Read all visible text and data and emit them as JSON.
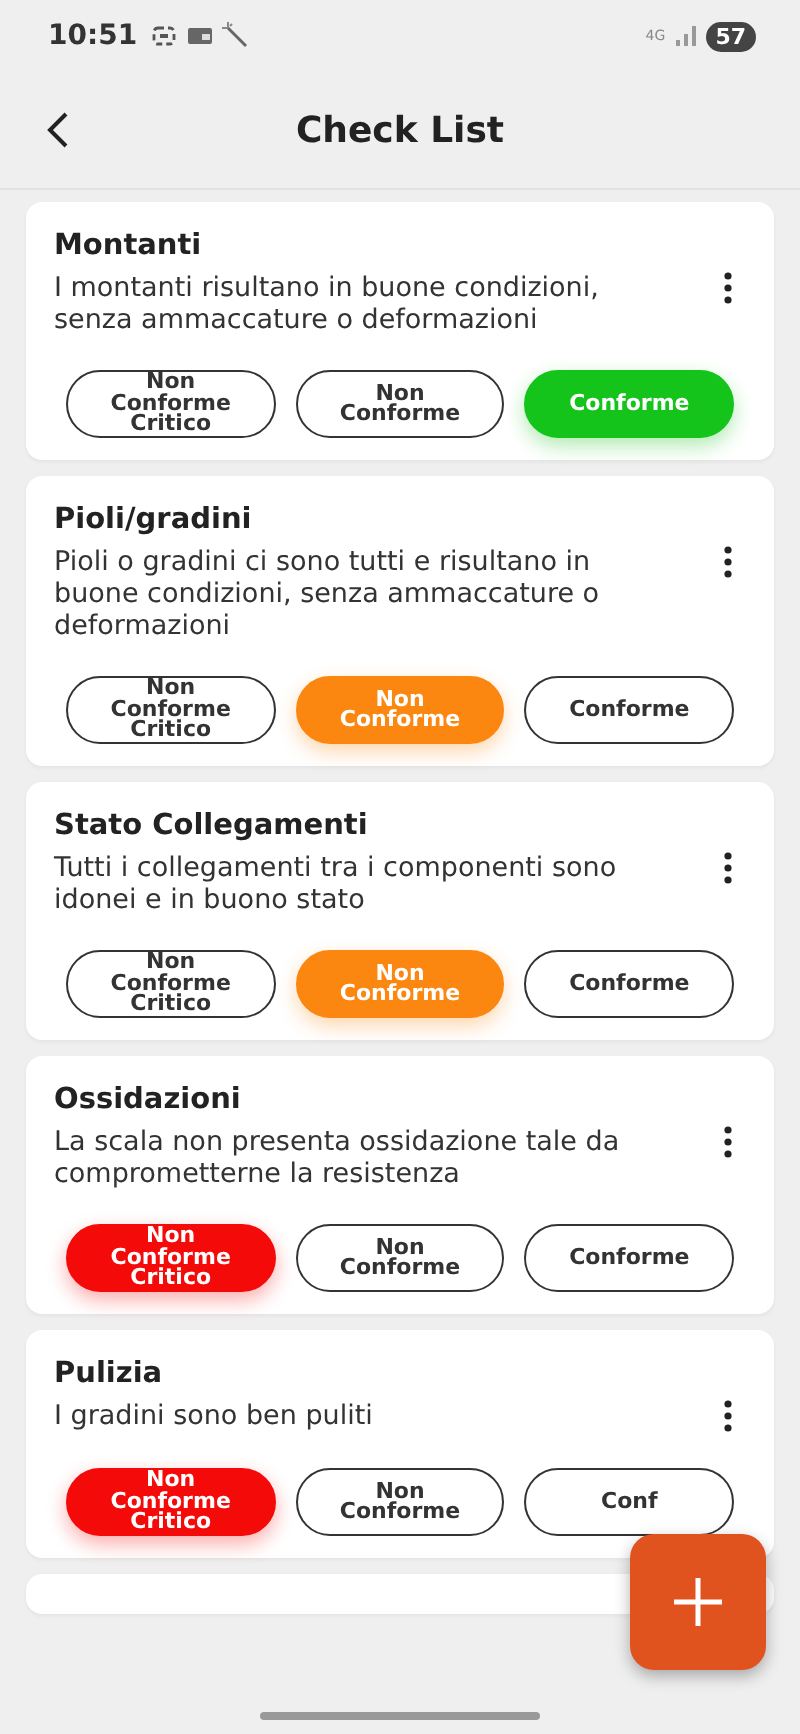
{
  "status_bar": {
    "time": "10:51",
    "network": "4G",
    "battery": "57"
  },
  "header": {
    "title": "Check List"
  },
  "items": [
    {
      "title": "Montanti",
      "description": "I montanti risultano in buone condizioni, senza ammaccature o deformazioni",
      "options": [
        {
          "kind": "critical",
          "label": "Non Conforme Critico",
          "selected": false
        },
        {
          "kind": "nonconform",
          "label": "Non Conforme",
          "selected": false
        },
        {
          "kind": "conform",
          "label": "Conforme",
          "selected": true
        }
      ]
    },
    {
      "title": "Pioli/gradini",
      "description": "Pioli o gradini ci sono tutti e risultano in buone condizioni, senza ammaccature o deformazioni",
      "options": [
        {
          "kind": "critical",
          "label": "Non Conforme Critico",
          "selected": false
        },
        {
          "kind": "nonconform",
          "label": "Non Conforme",
          "selected": true
        },
        {
          "kind": "conform",
          "label": "Conforme",
          "selected": false
        }
      ]
    },
    {
      "title": "Stato Collegamenti",
      "description": "Tutti i collegamenti tra i componenti sono idonei e in buono stato",
      "options": [
        {
          "kind": "critical",
          "label": "Non Conforme Critico",
          "selected": false
        },
        {
          "kind": "nonconform",
          "label": "Non Conforme",
          "selected": true
        },
        {
          "kind": "conform",
          "label": "Conforme",
          "selected": false
        }
      ]
    },
    {
      "title": "Ossidazioni",
      "description": "La scala non presenta ossidazione tale da comprometterne la resistenza",
      "options": [
        {
          "kind": "critical",
          "label": "Non Conforme Critico",
          "selected": true
        },
        {
          "kind": "nonconform",
          "label": "Non Conforme",
          "selected": false
        },
        {
          "kind": "conform",
          "label": "Conforme",
          "selected": false
        }
      ]
    },
    {
      "title": "Pulizia",
      "description": "I gradini sono ben puliti",
      "options": [
        {
          "kind": "critical",
          "label": "Non Conforme Critico",
          "selected": true
        },
        {
          "kind": "nonconform",
          "label": "Non Conforme",
          "selected": false
        },
        {
          "kind": "conform",
          "label": "Conf",
          "selected": false
        }
      ]
    }
  ]
}
